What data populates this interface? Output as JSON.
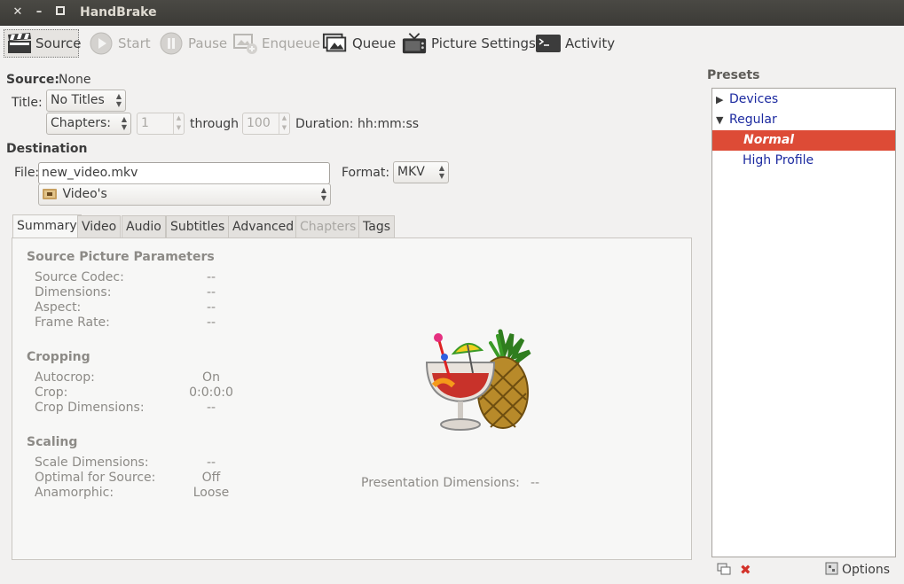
{
  "window": {
    "title": "HandBrake"
  },
  "toolbar": {
    "source": "Source",
    "start": "Start",
    "pause": "Pause",
    "enqueue": "Enqueue",
    "queue": "Queue",
    "picture_settings": "Picture Settings",
    "activity": "Activity"
  },
  "source": {
    "label": "Source:",
    "value": "None",
    "title_label": "Title:",
    "title_value": "No Titles",
    "chapters_value": "Chapters:",
    "chapter_start": "1",
    "through_label": "through",
    "chapter_end": "100",
    "duration_label": "Duration:",
    "duration_value": "hh:mm:ss"
  },
  "destination": {
    "heading": "Destination",
    "file_label": "File:",
    "file_value": "new_video.mkv",
    "format_label": "Format:",
    "format_value": "MKV",
    "folder_value": "Video's"
  },
  "tabs": [
    "Summary",
    "Video",
    "Audio",
    "Subtitles",
    "Advanced",
    "Chapters",
    "Tags"
  ],
  "summary": {
    "source_picture_heading": "Source Picture Parameters",
    "source_codec_label": "Source Codec:",
    "source_codec_value": "--",
    "dimensions_label": "Dimensions:",
    "dimensions_value": "--",
    "aspect_label": "Aspect:",
    "aspect_value": "--",
    "frame_rate_label": "Frame Rate:",
    "frame_rate_value": "--",
    "cropping_heading": "Cropping",
    "autocrop_label": "Autocrop:",
    "autocrop_value": "On",
    "crop_label": "Crop:",
    "crop_value": "0:0:0:0",
    "crop_dimensions_label": "Crop Dimensions:",
    "crop_dimensions_value": "--",
    "scaling_heading": "Scaling",
    "scale_dimensions_label": "Scale Dimensions:",
    "scale_dimensions_value": "--",
    "optimal_label": "Optimal for Source:",
    "optimal_value": "Off",
    "anamorphic_label": "Anamorphic:",
    "anamorphic_value": "Loose",
    "presentation_label": "Presentation Dimensions:",
    "presentation_value": "--"
  },
  "presets": {
    "heading": "Presets",
    "items": [
      {
        "label": "Devices",
        "type": "group",
        "expanded": false
      },
      {
        "label": "Regular",
        "type": "group",
        "expanded": true
      },
      {
        "label": "Normal",
        "type": "preset",
        "selected": true
      },
      {
        "label": "High Profile",
        "type": "preset",
        "selected": false
      }
    ],
    "options_label": "Options"
  },
  "colors": {
    "selection": "#dd4b36",
    "preset_link": "#1c2aa0",
    "titlebar": "#3c3b37"
  }
}
